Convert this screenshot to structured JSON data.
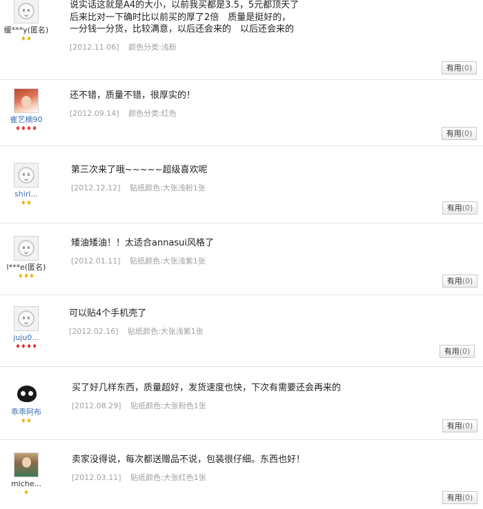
{
  "reviews": [
    {
      "user": "缓***y(匿名)",
      "avatar": "default-avatar",
      "badges": "♦♦",
      "badge_color": "gold",
      "lines": [
        "说实话这就是A4的大小，以前我买都是3.5，5元都顶天了",
        "后来比对一下确时比以前买的厚了2倍　质量是挺好的，",
        "一分钱一分货，比较满意，以后还会来的　以后还会来的"
      ],
      "date": "[2012.11.06]",
      "spec": "颜色分类:浅粉",
      "useful_label": "有用",
      "useful_count": "(0)"
    },
    {
      "user": "崔艺楠90",
      "avatar": "photo",
      "badges": "♦♦♦♦",
      "badge_color": "red",
      "lines": [
        "还不错，质量不错，很厚实的！"
      ],
      "date": "[2012.09.14]",
      "spec": "颜色分类:红色",
      "useful_label": "有用",
      "useful_count": "(0)"
    },
    {
      "user": "shirl...",
      "avatar": "default-avatar",
      "badges": "♦♦",
      "badge_color": "gold",
      "lines": [
        "第三次来了哦~~~~~超级喜欢呢"
      ],
      "date": "[2012.12.12]",
      "spec": "贴纸颜色:大张浅粉1张",
      "useful_label": "有用",
      "useful_count": "(0)"
    },
    {
      "user": "l***e(匿名)",
      "avatar": "default-avatar",
      "badges": "♦♦♦",
      "badge_color": "gold",
      "lines": [
        "矮油矮油！！太适合annasui风格了"
      ],
      "date": "[2012.01.11]",
      "spec": "贴纸颜色:大张浅紫1张",
      "useful_label": "有用",
      "useful_count": "(0)"
    },
    {
      "user": "juju0...",
      "avatar": "default-avatar",
      "badges": "♦♦♦♦",
      "badge_color": "red",
      "lines": [
        "可以贴4个手机壳了"
      ],
      "date": "[2012.02.16]",
      "spec": "贴纸颜色:大张浅紫1张",
      "useful_label": "有用",
      "useful_count": "(0)"
    },
    {
      "user": "乖乖阿布",
      "avatar": "photo",
      "badges": "♦♦",
      "badge_color": "gold",
      "lines": [
        "买了好几样东西，质量超好，发货速度也快，下次有需要还会再来的"
      ],
      "date": "[2012.08.29]",
      "spec": "贴纸颜色:大张粉色1张",
      "useful_label": "有用",
      "useful_count": "(0)"
    },
    {
      "user": "miche...",
      "avatar": "photo",
      "badges": "♦",
      "badge_color": "gold",
      "lines": [
        "卖家没得说，每次都送赠品不说，包装很仔细。东西也好！"
      ],
      "date": "[2012.03.11]",
      "spec": "贴纸颜色:大张红色1张",
      "useful_label": "有用",
      "useful_count": "(0)"
    }
  ]
}
